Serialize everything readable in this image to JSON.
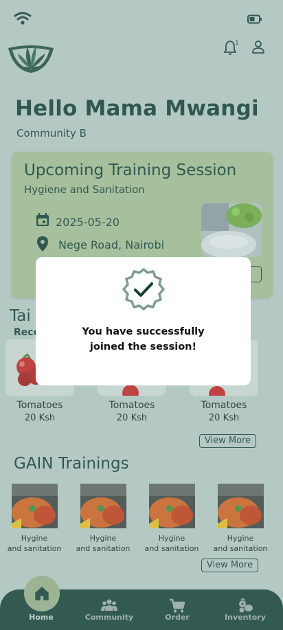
{
  "header": {
    "notification_count": "1",
    "greeting": "Hello Mama Mwangi",
    "community": "Community B"
  },
  "training_card": {
    "title": "Upcoming Training Session",
    "subtitle": "Hygiene and Sanitation",
    "date": "2025-05-20",
    "location": "Nege Road, Nairobi"
  },
  "products_section": {
    "title_partial": "Tai",
    "recent_partial": "Rece",
    "items": [
      {
        "name": "Tomatoes",
        "price": "20 Ksh"
      },
      {
        "name": "Tomatoes",
        "price": "20 Ksh"
      },
      {
        "name": "Tomatoes",
        "price": "20 Ksh"
      }
    ],
    "view_more": "View More"
  },
  "gain_section": {
    "title": "GAIN Trainings",
    "items": [
      {
        "line1": "Hygine",
        "line2": "and sanitation"
      },
      {
        "line1": "Hygine",
        "line2": "and sanitation"
      },
      {
        "line1": "Hygine",
        "line2": "and sanitation"
      },
      {
        "line1": "Hygine",
        "line2": "and sanitation"
      }
    ],
    "view_more": "View More"
  },
  "nav": {
    "home": "Home",
    "community": "Community",
    "order": "Order",
    "inventory": "Inventory"
  },
  "modal": {
    "line1": "You have successfully",
    "line2": "joined the session!"
  },
  "colors": {
    "background": "#bcd0cb",
    "card": "#a8c497",
    "nav": "#0f3d32",
    "accent": "#9bb58a"
  }
}
